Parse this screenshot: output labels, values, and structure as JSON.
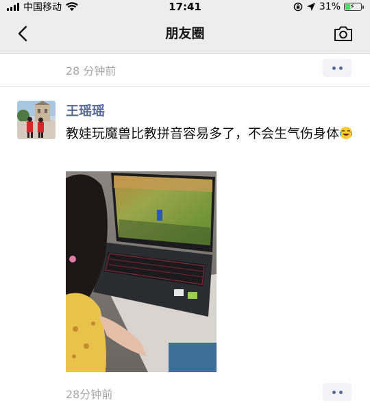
{
  "status_bar": {
    "carrier": "中国移动",
    "time": "17:41",
    "battery": "31%",
    "battery_level": 0.31
  },
  "nav": {
    "title": "朋友圈"
  },
  "feed": {
    "previous_post_time": "28 分钟前",
    "post": {
      "author": "王瑶瑶",
      "text": "教娃玩魔兽比教拼音容易多了，不会生气伤身体",
      "time": "28分钟前"
    }
  },
  "colors": {
    "link": "#576b95",
    "nav_bg": "#ededed",
    "meta_text": "#a6a6a6"
  }
}
